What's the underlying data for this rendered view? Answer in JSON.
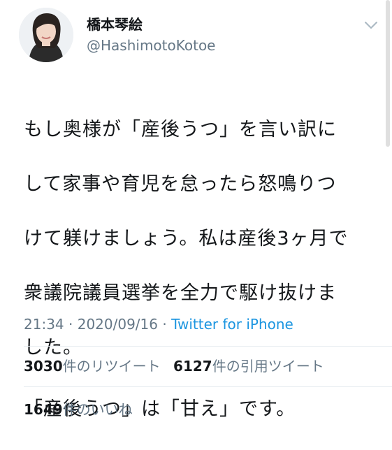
{
  "user": {
    "display_name": "橋本琴絵",
    "handle": "@HashimotoKotoe"
  },
  "tweet": {
    "lines": [
      "もし奥様が「産後うつ」を言い訳に",
      "して家事や育児を怠ったら怒鳴りつ",
      "けて躾けましょう。私は産後3ヶ月で",
      "衆議院議員選挙を全力で駆け抜けま",
      "した。"
    ],
    "line2": "「産後うつ」は「甘え」です。"
  },
  "meta": {
    "time": "21:34",
    "sep1": " · ",
    "date": "2020/09/16",
    "sep2": " · ",
    "source": "Twitter for iPhone"
  },
  "stats": {
    "retweets_count": "3030",
    "retweets_label": "件のリツイート",
    "quotes_count": "6127",
    "quotes_label": "件の引用ツイート",
    "likes_count": "1649",
    "likes_label": "件のいいね"
  },
  "colors": {
    "text": "#14171a",
    "muted": "#657786",
    "link": "#1b95e0"
  },
  "icons": {
    "menu": "chevron-down-icon"
  }
}
